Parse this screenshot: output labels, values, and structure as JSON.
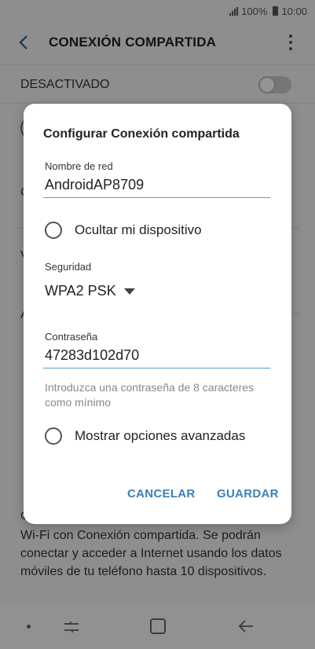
{
  "status": {
    "signal": ".ıl",
    "battery": "100%",
    "time": "10:00"
  },
  "header": {
    "title": "CONEXIÓN COMPARTIDA"
  },
  "toggle_row": {
    "label": "DESACTIVADO",
    "state": "off"
  },
  "background": {
    "fragments": [
      "C",
      "V",
      "A",
      "G"
    ],
    "info_text": "Wi-Fi con Conexión compartida. Se podrán conectar y acceder a Internet usando los datos móviles de tu teléfono hasta 10 dispositivos."
  },
  "dialog": {
    "title": "Configurar Conexión compartida",
    "network_name": {
      "label": "Nombre de red",
      "value": "AndroidAP8709"
    },
    "hide_device": {
      "label": "Ocultar mi dispositivo",
      "checked": false
    },
    "security": {
      "label": "Seguridad",
      "value": "WPA2 PSK"
    },
    "password": {
      "label": "Contraseña",
      "value": "47283d102d70",
      "helper": "Introduzca una contraseña de 8 caracteres como mínimo"
    },
    "advanced": {
      "label": "Mostrar opciones avanzadas",
      "checked": false
    },
    "buttons": {
      "cancel": "CANCELAR",
      "save": "GUARDAR"
    }
  },
  "colors": {
    "accent": "#3b7fb5",
    "underline": "#4f9fd6",
    "scrim": "rgba(0,0,0,0.42)"
  }
}
